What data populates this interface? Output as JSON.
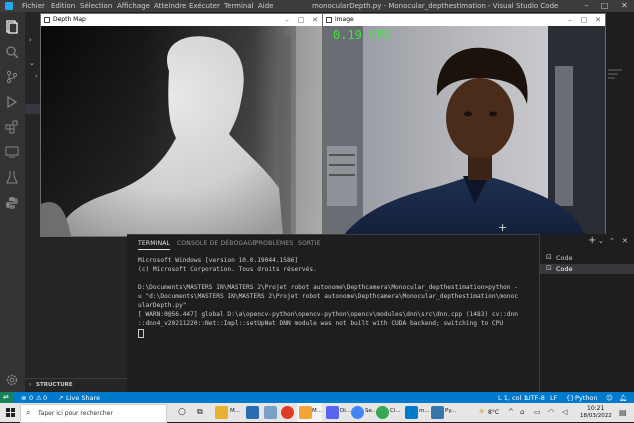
{
  "vscode": {
    "menu": [
      "Fichier",
      "Edition",
      "Sélection",
      "Affichage",
      "Atteindre",
      "Exécuter",
      "Terminal",
      "Aide"
    ],
    "title": "monocularDepth.py - Monocular_depthestimation - Visual Studio Code"
  },
  "depth_window": {
    "title": "Depth Map"
  },
  "image_window": {
    "title": "image",
    "fps": "0.19 FPS"
  },
  "sidebar": {
    "structure": "STRUCTURE"
  },
  "panel": {
    "tabs": [
      "TERMINAL",
      "CONSOLE DE DÉBOGAGE",
      "PROBLÈMES",
      "SORTIE"
    ],
    "terminal_lines": [
      "Microsoft Windows [version 10.0.19044.1586]",
      "(c) Microsoft Corporation. Tous droits réservés.",
      "",
      "D:\\Documents\\MASTERS IN\\MASTERS 2\\Projet robot autonome\\Depthcamera\\Monocular_depthestimation>python -",
      "u \"d:\\Documents\\MASTERS IN\\MASTERS 2\\Projet robot autonome\\Depthcamera\\Monocular_depthestimation\\monoc",
      "ularDepth.py\"",
      "[ WARN:0@56.447] global D:\\a\\opencv-python\\opencv-python\\opencv\\modules\\dnn\\src\\dnn.cpp (1483) cv::dnn",
      "::dnn4_v20211220::Net::Impl::setUpNet DNN module was not built with CUDA backend; switching to CPU"
    ],
    "terminals": [
      "Code",
      "Code"
    ],
    "plus": "+"
  },
  "statusbar": {
    "errors": "0",
    "warnings": "0",
    "live_share": "Live Share",
    "position": "L 1, col 1",
    "encoding": "UTF-8",
    "eol": "LF",
    "language": "Python"
  },
  "taskbar": {
    "search_placeholder": "Taper ici pour rechercher",
    "weather": "8°C",
    "time": "10:21",
    "date": "18/03/2022",
    "labels": [
      "M...",
      "M...",
      "Di...",
      "Se...",
      "Ci...",
      "m...",
      "Py..."
    ]
  }
}
